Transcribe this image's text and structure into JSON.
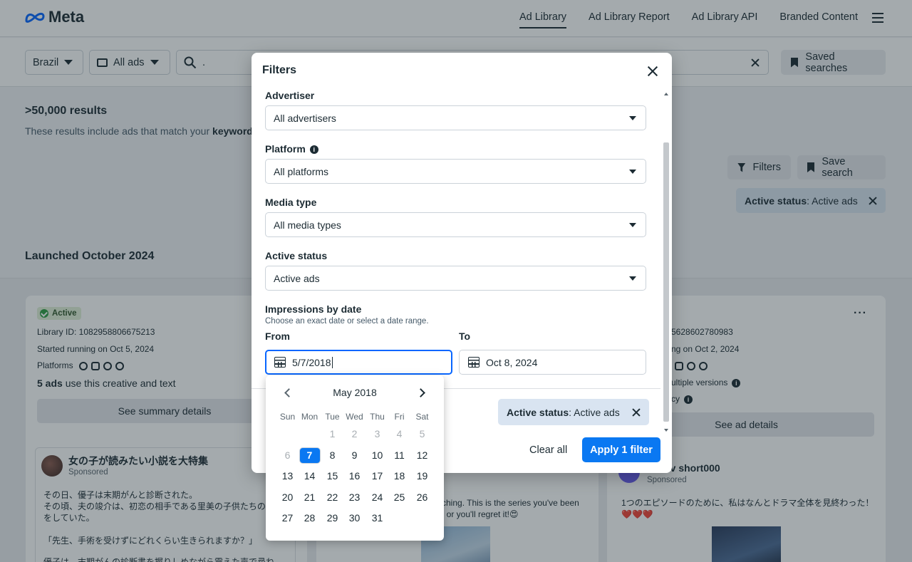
{
  "nav": {
    "logo": "Meta",
    "links": [
      "Ad Library",
      "Ad Library Report",
      "Ad Library API",
      "Branded Content"
    ]
  },
  "searchbar": {
    "country": "Brazil",
    "ad_type": "All ads",
    "query": ".",
    "saved_searches": "Saved searches"
  },
  "results": {
    "count": ">50,000 results",
    "sub_prefix": "These results include ads that match your ",
    "sub_bold": "keyword s",
    "filters_btn": "Filters",
    "save_search_btn": "Save search",
    "chip_key": "Active status",
    "chip_value": ": Active ads",
    "launched": "Launched October 2024"
  },
  "cards": {
    "left": {
      "status": "Active",
      "library_id": "Library ID: 1082958806675213",
      "started": "Started running on Oct 5, 2024",
      "platforms_label": "Platforms",
      "ads_bold": "5 ads",
      "ads_rest": " use this creative and text",
      "summary_btn": "See summary details",
      "advertiser": "女の子が読みたい小説を大特集",
      "sponsored": "Sponsored",
      "text1": "その日、優子は末期がんと診断された。",
      "text2": "その頃、夫の竣介は、初恋の相手である里美の子供たちのせ",
      "text3": "をしていた。",
      "text4": "「先生、手術を受けずにどれくらい生きられますか？」",
      "text5": "優子は、末期がんの診断書を握りしめながら震えた声で尋ね"
    },
    "middle": {
      "text1": "ching. This is the series you've been",
      "text2": ", or you'll regret it!😍"
    },
    "right": {
      "library_id": "5628602780983",
      "started": "ng on Oct 2, 2024",
      "versions": "ultiple versions",
      "cy": "cy",
      "details_btn": "See ad details",
      "advertiser": "tv short000",
      "sponsored": "Sponsored",
      "text1": "1つのエピソードのために、私はなんとドラマ全体を見終わった！",
      "text2": "❤️❤️❤️"
    }
  },
  "modal": {
    "title": "Filters",
    "advertiser_label": "Advertiser",
    "advertiser_value": "All advertisers",
    "platform_label": "Platform",
    "platform_value": "All platforms",
    "media_label": "Media type",
    "media_value": "All media types",
    "status_label": "Active status",
    "status_value": "Active ads",
    "impressions_label": "Impressions by date",
    "impressions_sub": "Choose an exact date or select a date range.",
    "from_label": "From",
    "to_label": "To",
    "from_value": "5/7/2018",
    "to_value": "Oct 8, 2024",
    "chip_key": "Active status",
    "chip_value": ": Active ads",
    "clear_all": "Clear all",
    "apply": "Apply 1 filter"
  },
  "calendar": {
    "month": "May 2018",
    "weekdays": [
      "Sun",
      "Mon",
      "Tue",
      "Wed",
      "Thu",
      "Fri",
      "Sat"
    ],
    "weeks": [
      [
        "",
        "",
        "1",
        "2",
        "3",
        "4",
        "5"
      ],
      [
        "6",
        "7",
        "8",
        "9",
        "10",
        "11",
        "12"
      ],
      [
        "13",
        "14",
        "15",
        "16",
        "17",
        "18",
        "19"
      ],
      [
        "20",
        "21",
        "22",
        "23",
        "24",
        "25",
        "26"
      ],
      [
        "27",
        "28",
        "29",
        "30",
        "31",
        "",
        ""
      ]
    ],
    "disabled": [
      "1",
      "2",
      "3",
      "4",
      "5",
      "6"
    ],
    "selected": "7"
  },
  "colors": {
    "accent": "#0a78f2",
    "chip_bg": "#d9e4f1",
    "active_badge": "#e1f0d7"
  }
}
